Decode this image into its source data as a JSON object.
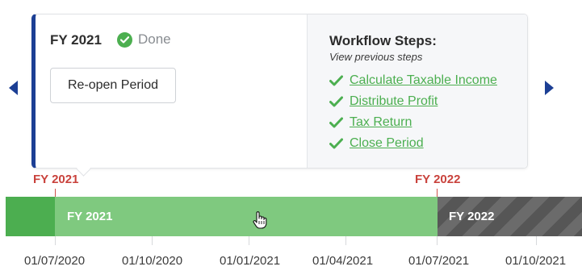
{
  "period_card": {
    "title": "FY 2021",
    "status": "Done",
    "status_icon": "check-circle-icon",
    "reopen_label": "Re-open Period"
  },
  "workflow": {
    "title": "Workflow Steps:",
    "subtitle": "View previous steps",
    "steps": [
      {
        "label": "Calculate Taxable Income",
        "icon": "check-icon"
      },
      {
        "label": "Distribute Profit",
        "icon": "check-icon"
      },
      {
        "label": "Tax Return",
        "icon": "check-icon"
      },
      {
        "label": "Close Period",
        "icon": "check-icon"
      }
    ]
  },
  "nav": {
    "prev_icon": "chevron-left-icon",
    "next_icon": "chevron-right-icon"
  },
  "timeline": {
    "markers": [
      "FY 2021",
      "FY 2022"
    ],
    "segments": [
      "FY 2021",
      "FY 2022"
    ],
    "ticks": [
      "01/07/2020",
      "01/10/2020",
      "01/01/2021",
      "01/04/2021",
      "01/07/2021",
      "01/10/2021"
    ]
  },
  "colors": {
    "accent_blue": "#1c3f94",
    "done_green": "#4caf50",
    "timeline_green": "#7fc97f",
    "timeline_dark_green": "#4cae50",
    "marker_red": "#c9423c",
    "future_gray": "#6b6b6b"
  }
}
